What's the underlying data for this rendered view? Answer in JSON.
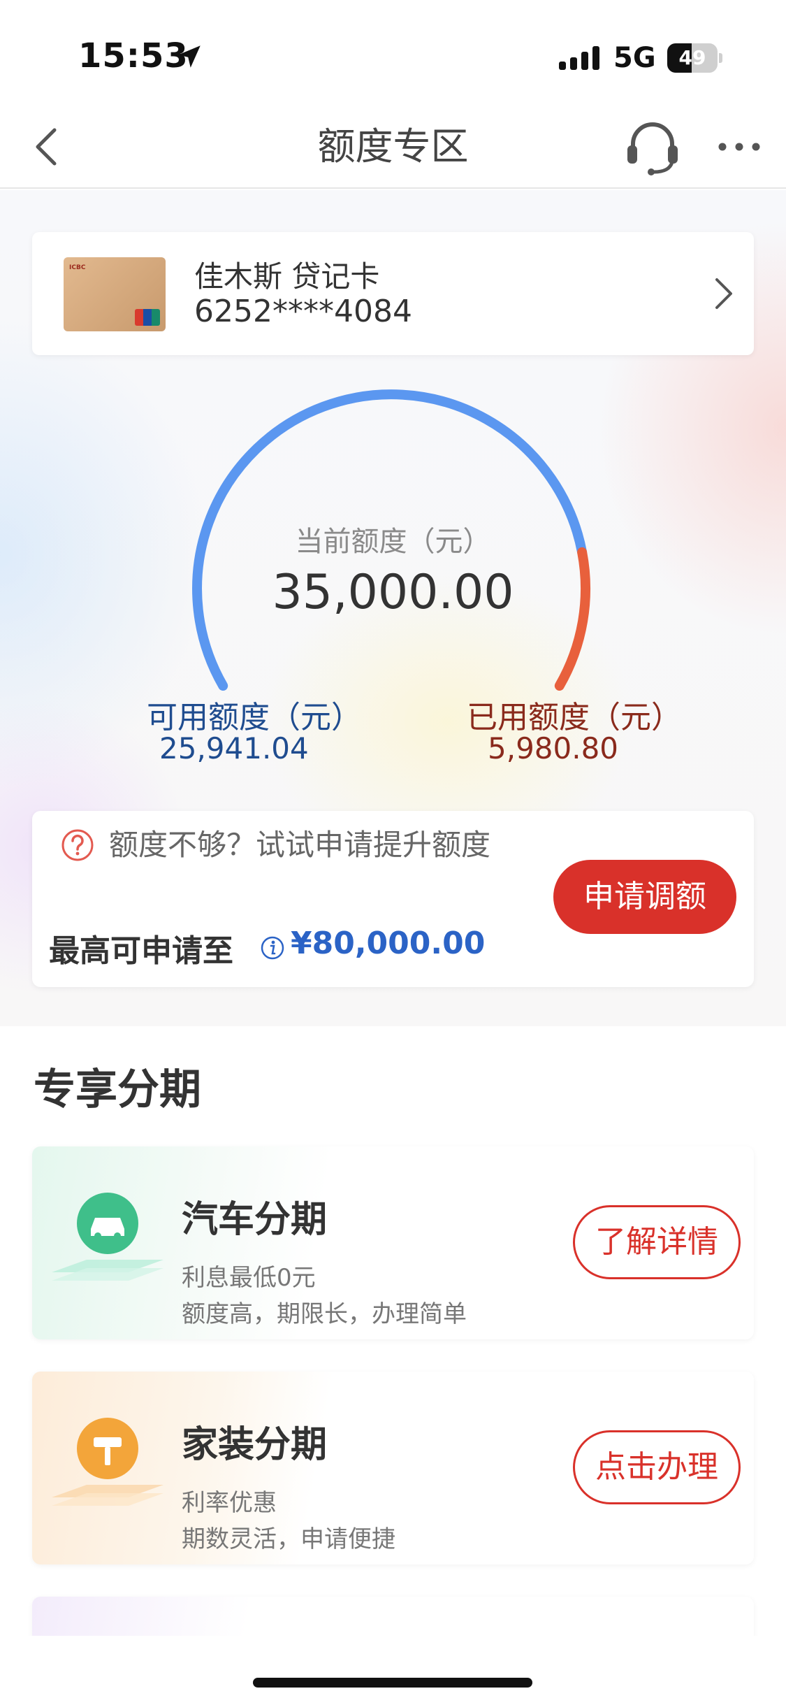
{
  "status_bar": {
    "time": "15:53",
    "network": "5G",
    "battery_level": "49",
    "battery_fraction": 0.49
  },
  "navbar": {
    "title": "额度专区",
    "icons": [
      "back-chevron-icon",
      "headset-icon",
      "more-dots-icon"
    ]
  },
  "card": {
    "name": "佳木斯 贷记卡",
    "number": "6252****4084"
  },
  "gauge": {
    "caption": "当前额度（元）",
    "total": "35,000.00",
    "available_label": "可用额度（元）",
    "available_value": "25,941.04",
    "used_label": "已用额度（元）",
    "used_value": "5,980.80",
    "used_fraction": 0.17,
    "colors": {
      "available": "#5b97f0",
      "used": "#e8603c"
    }
  },
  "upgrade": {
    "text": "额度不够？试试申请提升额度",
    "max_label": "最高可申请至",
    "max_value": "¥80,000.00",
    "button": "申请调额"
  },
  "section": {
    "title": "专享分期"
  },
  "promos": [
    {
      "title": "汽车分期",
      "sub1": "利息最低0元",
      "sub2": "额度高，期限长，办理简单",
      "button": "了解详情",
      "icon": "car-icon",
      "color": "#3fbf8a"
    },
    {
      "title": "家装分期",
      "sub1": "利率优惠",
      "sub2": "期数灵活，申请便捷",
      "button": "点击办理",
      "icon": "paint-roller-icon",
      "color": "#f3a53a"
    }
  ],
  "accent": {
    "red": "#d9312a",
    "blue": "#2b63c6"
  }
}
